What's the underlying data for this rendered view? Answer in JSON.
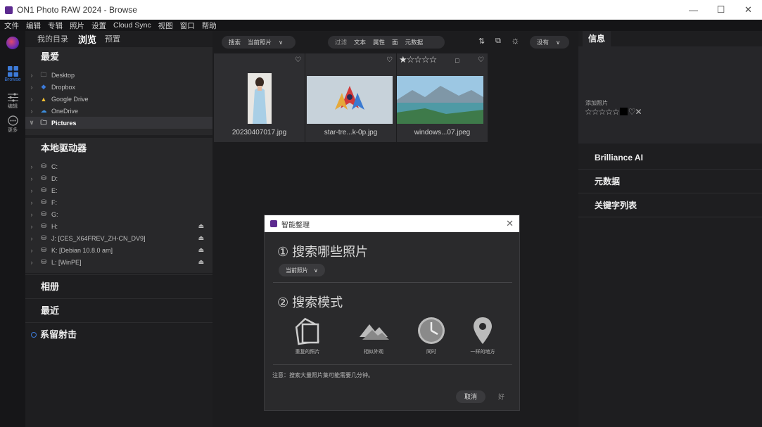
{
  "window": {
    "title": "ON1 Photo RAW 2024 - Browse",
    "minimize": "—",
    "maximize": "☐",
    "close": "✕"
  },
  "menu": [
    "文件",
    "编辑",
    "专辑",
    "照片",
    "设置",
    "Cloud Sync",
    "视图",
    "窗口",
    "帮助"
  ],
  "rail": {
    "browse": "Browse",
    "edit": "编辑",
    "more": "更多"
  },
  "sidebar": {
    "tabs": {
      "my_catalog": "我的目录",
      "browse": "浏览",
      "presets": "预置"
    },
    "favorites": {
      "title": "最爱",
      "items": [
        {
          "label": "Desktop",
          "icon": "folder-icon"
        },
        {
          "label": "Dropbox",
          "icon": "dropbox-icon"
        },
        {
          "label": "Google Drive",
          "icon": "google-drive-icon"
        },
        {
          "label": "OneDrive",
          "icon": "onedrive-icon"
        },
        {
          "label": "Pictures",
          "icon": "folder-icon",
          "selected": true
        }
      ]
    },
    "local_drives": {
      "title": "本地驱动器",
      "items": [
        {
          "label": "C:",
          "eject": false
        },
        {
          "label": "D:",
          "eject": false
        },
        {
          "label": "E:",
          "eject": false
        },
        {
          "label": "F:",
          "eject": false
        },
        {
          "label": "G:",
          "eject": false
        },
        {
          "label": "H:",
          "eject": true
        },
        {
          "label": "J: [CES_X64FREV_ZH-CN_DV9]",
          "eject": true
        },
        {
          "label": "K: [Debian 10.8.0 am]",
          "eject": true
        },
        {
          "label": "L: [WinPE]",
          "eject": true
        }
      ]
    },
    "albums": "相册",
    "recent": "最近",
    "tethered": "系留射击"
  },
  "toolbar": {
    "search": "搜索",
    "scope": "当前照片",
    "scope_chev": "∨",
    "filters": [
      "过滤",
      "文本",
      "属性",
      "面",
      "元数据"
    ],
    "sort": "没有",
    "sort_chev": "∨"
  },
  "thumbnails": [
    {
      "name": "20230407017.jpg",
      "heart": "♡"
    },
    {
      "name": "star-tre...k-0p.jpg",
      "heart": "♡"
    },
    {
      "name": "windows...07.jpeg",
      "heart": "♡",
      "stars": "★☆☆☆☆",
      "badge": "□"
    }
  ],
  "right_panel": {
    "tab": "信息",
    "label": "添加照片",
    "rating": "☆☆☆☆☆",
    "rating_extra": "♡✕",
    "sections": [
      "Brilliance AI",
      "元数据",
      "关键字列表"
    ]
  },
  "dialog": {
    "title": "智能整理",
    "close": "✕",
    "step1": "① 搜索哪些照片",
    "step1_value": "当前照片",
    "step1_chev": "∨",
    "step2": "② 搜索模式",
    "modes": [
      {
        "label": "重复的照片",
        "icon": "duplicate-photos-icon"
      },
      {
        "label": "相似外观",
        "icon": "similar-look-icon"
      },
      {
        "label": "同时",
        "icon": "clock-icon"
      },
      {
        "label": "一样的地方",
        "icon": "location-pin-icon"
      }
    ],
    "note": "注意：搜索大量照片集可能需要几分钟。",
    "cancel": "取消",
    "ok": "好"
  }
}
